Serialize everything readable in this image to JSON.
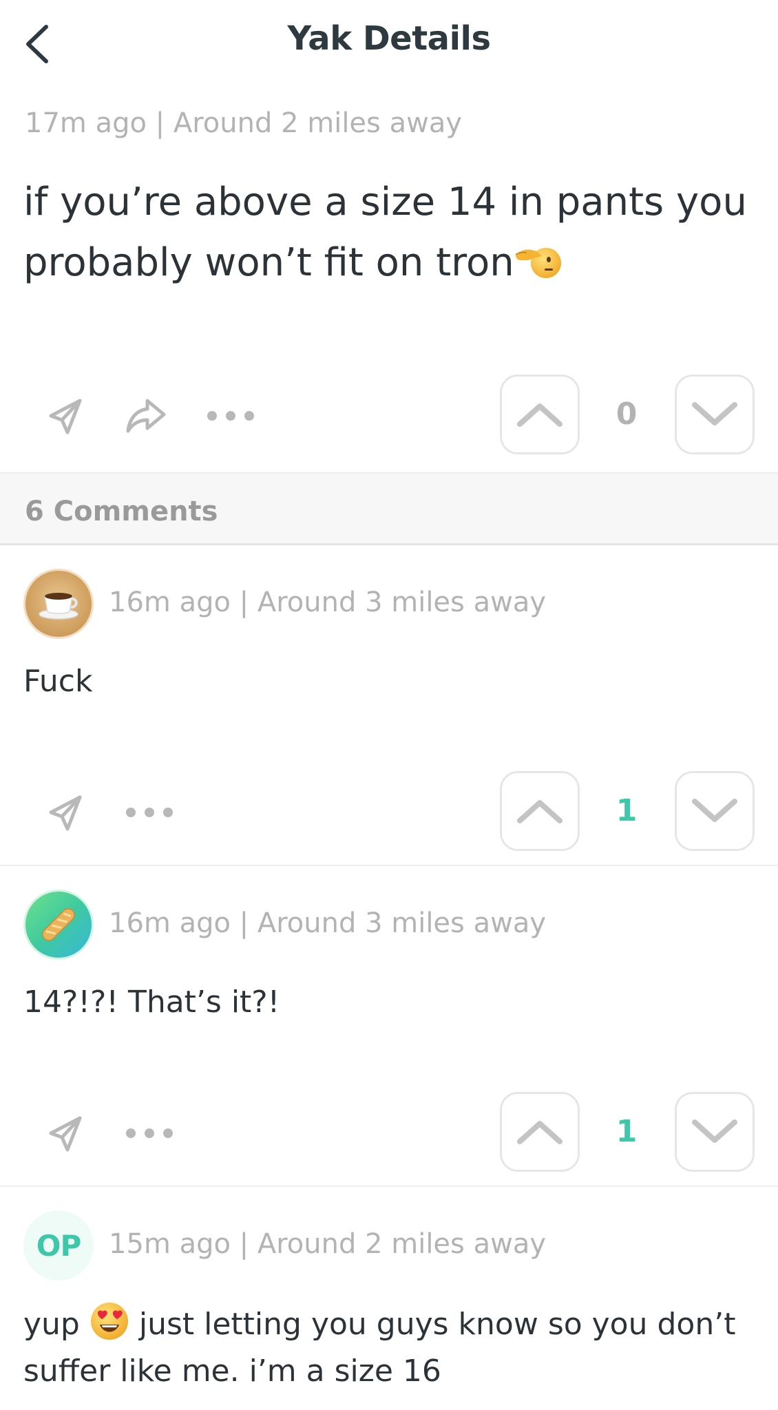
{
  "header": {
    "title": "Yak Details"
  },
  "post": {
    "meta": "17m ago | Around 2 miles away",
    "text": "if you’re above a size 14 in pants you probably won’t fit on tron",
    "vote_count": "0"
  },
  "comments_header": {
    "label": "6 Comments"
  },
  "comments": [
    {
      "avatar": "coffee-emoji",
      "meta": "16m ago | Around 3 miles away",
      "text": "Fuck",
      "vote_count": "1"
    },
    {
      "avatar": "baguette-emoji",
      "meta": "16m ago | Around 3 miles away",
      "text": "14?!?! That’s it?!",
      "vote_count": "1"
    },
    {
      "avatar_label": "OP",
      "meta": "15m ago | Around 2 miles away",
      "text_before": "yup",
      "text_after": "just letting you guys know so you don’t suffer like me. i’m a size 16"
    }
  ],
  "colors": {
    "accent": "#3ec7a8",
    "meta_gray": "#b3b3b3",
    "text_dark": "#2b3338"
  },
  "icons": [
    "chevron-left-icon",
    "send-icon",
    "share-icon",
    "more-icon",
    "upvote-icon",
    "downvote-icon"
  ]
}
